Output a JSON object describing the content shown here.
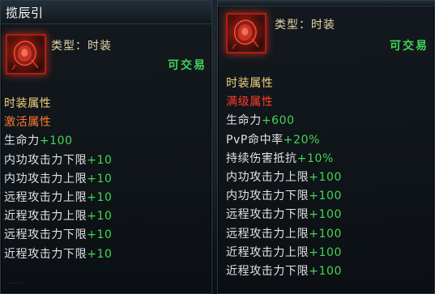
{
  "left_tooltip": {
    "title": "揽辰引",
    "type_label": "类型：时装",
    "tradeable": "可交易",
    "section_title": "时装属性",
    "section_subtitle": "激活属性",
    "attributes": [
      {
        "name": "生命力",
        "value": "+100"
      },
      {
        "name": "内功攻击力下限",
        "value": "+10"
      },
      {
        "name": "内功攻击力上限",
        "value": "+10"
      },
      {
        "name": "远程攻击力上限",
        "value": "+10"
      },
      {
        "name": "近程攻击力上限",
        "value": "+10"
      },
      {
        "name": "远程攻击力下限",
        "value": "+10"
      },
      {
        "name": "近程攻击力下限",
        "value": "+10"
      }
    ],
    "icon": "fashion-item-icon"
  },
  "right_tooltip": {
    "type_label": "类型：时装",
    "tradeable": "可交易",
    "section_title": "时装属性",
    "section_subtitle": "满级属性",
    "attributes": [
      {
        "name": "生命力",
        "value": "+600"
      },
      {
        "name": "PvP命中率",
        "value": "+20%"
      },
      {
        "name": "持续伤害抵抗",
        "value": "+10%"
      },
      {
        "name": "内功攻击力上限",
        "value": "+100"
      },
      {
        "name": "内功攻击力下限",
        "value": "+100"
      },
      {
        "name": "远程攻击力下限",
        "value": "+100"
      },
      {
        "name": "远程攻击力上限",
        "value": "+100"
      },
      {
        "name": "近程攻击力上限",
        "value": "+100"
      },
      {
        "name": "近程攻击力下限",
        "value": "+100"
      }
    ],
    "icon": "fashion-item-icon"
  },
  "colors": {
    "section_title": "#f0d27a",
    "active_subtitle": "#ff7a2b",
    "max_subtitle": "#ff3b2a",
    "attr_name": "#e2e2e2",
    "attr_value": "#44d654",
    "tradeable": "#43d35a"
  }
}
